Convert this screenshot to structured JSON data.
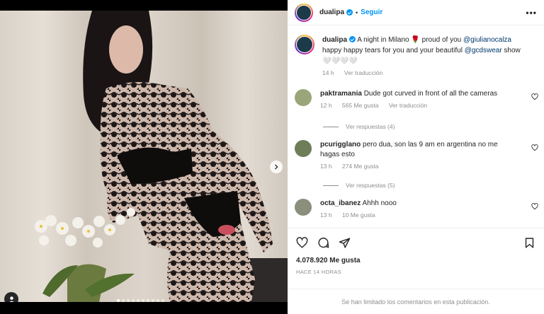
{
  "header": {
    "username": "dualipa",
    "separator": "•",
    "follow_label": "Seguir",
    "more_label": "•••"
  },
  "caption": {
    "username": "dualipa",
    "text_part1": " A night in Milano 🌹 proud of you ",
    "mention1": "@giulianocalza",
    "text_part2": " happy happy tears for you and your beautiful ",
    "mention2": "@gcdswear",
    "text_part3": " show 🤍🤍🤍🤍",
    "time": "14 h",
    "translate": "Ver traducción"
  },
  "comments": [
    {
      "username": "paktramania",
      "text": "Dude got curved in front of all the cameras",
      "time": "12 h",
      "likes": "565 Me gusta",
      "translate": "Ver traducción",
      "replies": "Ver respuestas (4)",
      "avatar_color": "#9aa67a"
    },
    {
      "username": "pcurigglano",
      "text": "pero dua, son las 9 am en argentina no me hagas esto",
      "time": "13 h",
      "likes": "274 Me gusta",
      "replies": "Ver respuestas (5)",
      "avatar_color": "#6f7d58"
    },
    {
      "username": "octa_ibanez",
      "text": "Ahhh nooo",
      "time": "13 h",
      "likes": "10 Me gusta",
      "avatar_color": "#8a8f7c"
    }
  ],
  "actions": {
    "icons": [
      "heart-icon",
      "comment-icon",
      "share-icon",
      "bookmark-icon"
    ],
    "likes": "4.078.920 Me gusta",
    "posted": "HACE 14 HORAS"
  },
  "footer": {
    "limited_text": "Se han limitado los comentarios en esta publicación."
  },
  "media": {
    "carousel_count": 10,
    "carousel_active": 1
  },
  "colors": {
    "accent": "#0095f6",
    "mention": "#00376b",
    "muted": "#8e8e8e"
  }
}
